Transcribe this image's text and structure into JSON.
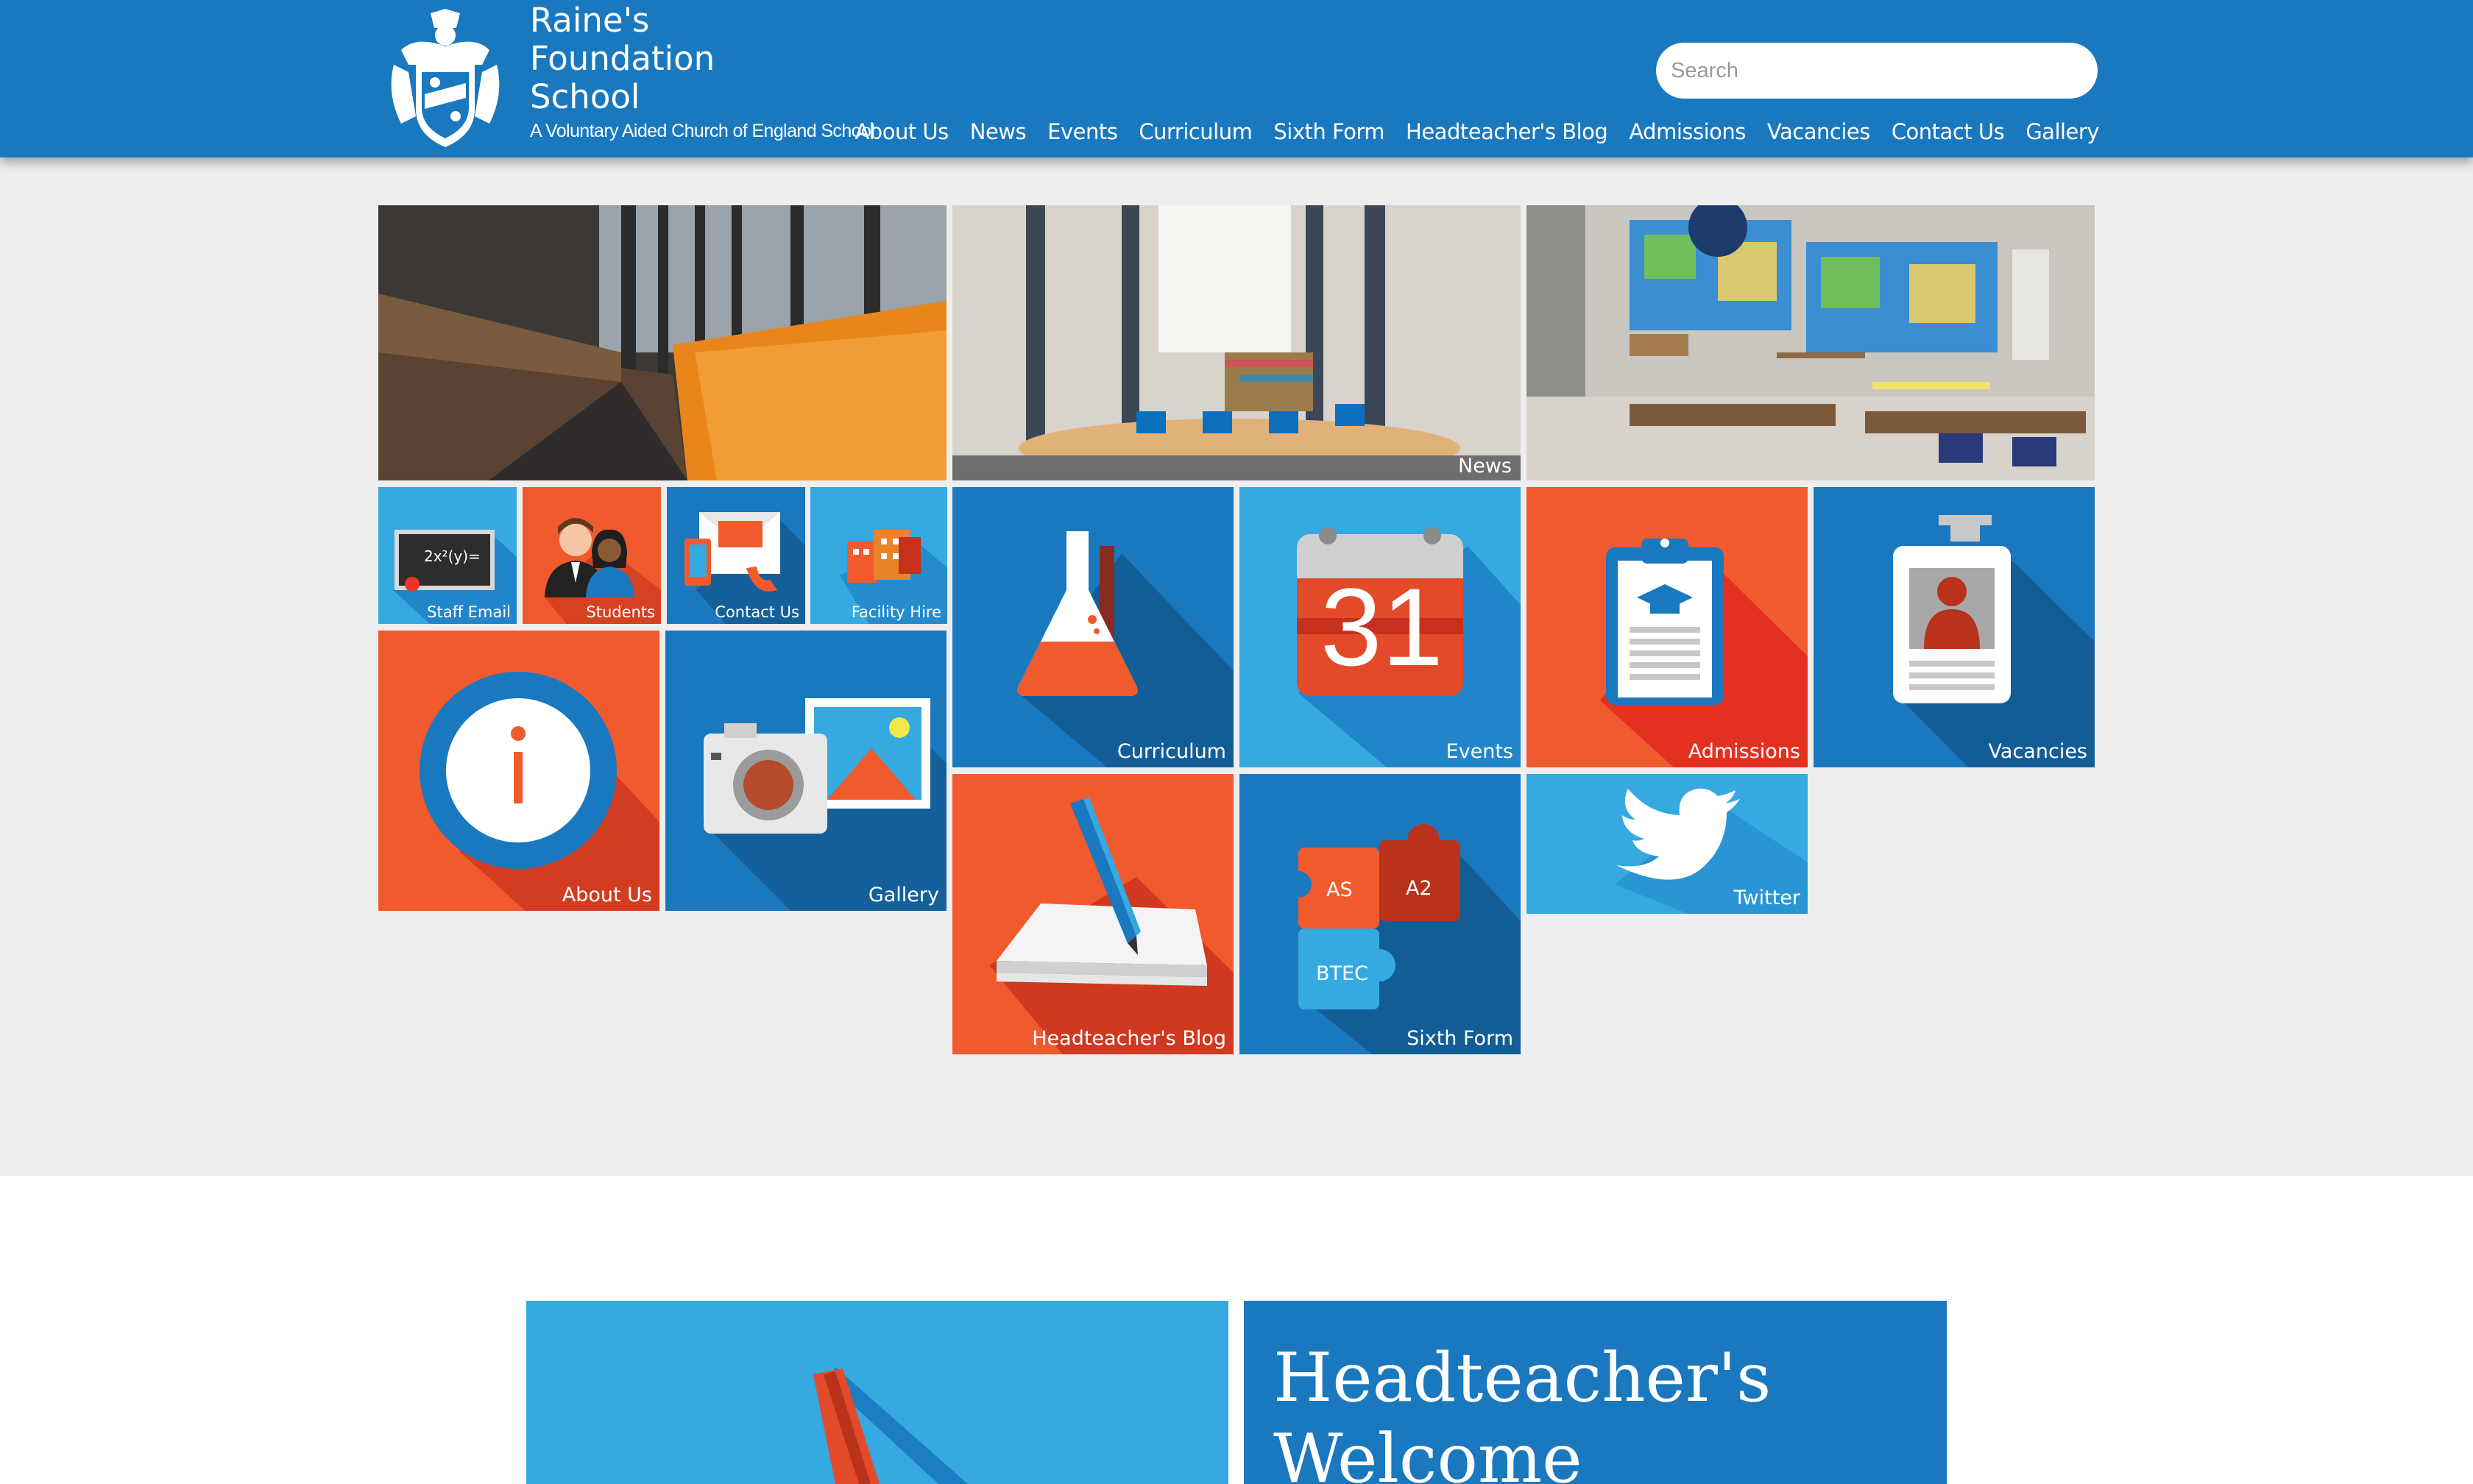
{
  "brand": {
    "name": "Raine's Foundation School",
    "name_lines": [
      "Raine's",
      "Foundation",
      "School"
    ],
    "subtitle": "A Voluntary Aided Church of England School"
  },
  "search": {
    "placeholder": "Search"
  },
  "nav": [
    "About Us",
    "News",
    "Events",
    "Curriculum",
    "Sixth Form",
    "Headteacher's Blog",
    "Admissions",
    "Vacancies",
    "Contact Us",
    "Gallery"
  ],
  "tiles": {
    "news": "News",
    "staff_email": "Staff Email",
    "chalkboard_text": "2x²(y)=",
    "students": "Students",
    "contact_us": "Contact Us",
    "facility_hire": "Facility Hire",
    "about_us": "About Us",
    "gallery": "Gallery",
    "curriculum": "Curriculum",
    "events": "Events",
    "calendar_day": "31",
    "admissions": "Admissions",
    "vacancies": "Vacancies",
    "headteachers_blog": "Headteacher's Blog",
    "sixth_form": "Sixth Form",
    "puzzle_as": "AS",
    "puzzle_a2": "A2",
    "puzzle_btec": "BTEC",
    "twitter": "Twitter"
  },
  "welcome": {
    "title_line1": "Headteacher's",
    "title_line2": "Welcome"
  },
  "colors": {
    "header_blue": "#1a78bf",
    "light_blue": "#35a9e0",
    "orange": "#f05a2c",
    "background_grey": "#eeeeee"
  }
}
